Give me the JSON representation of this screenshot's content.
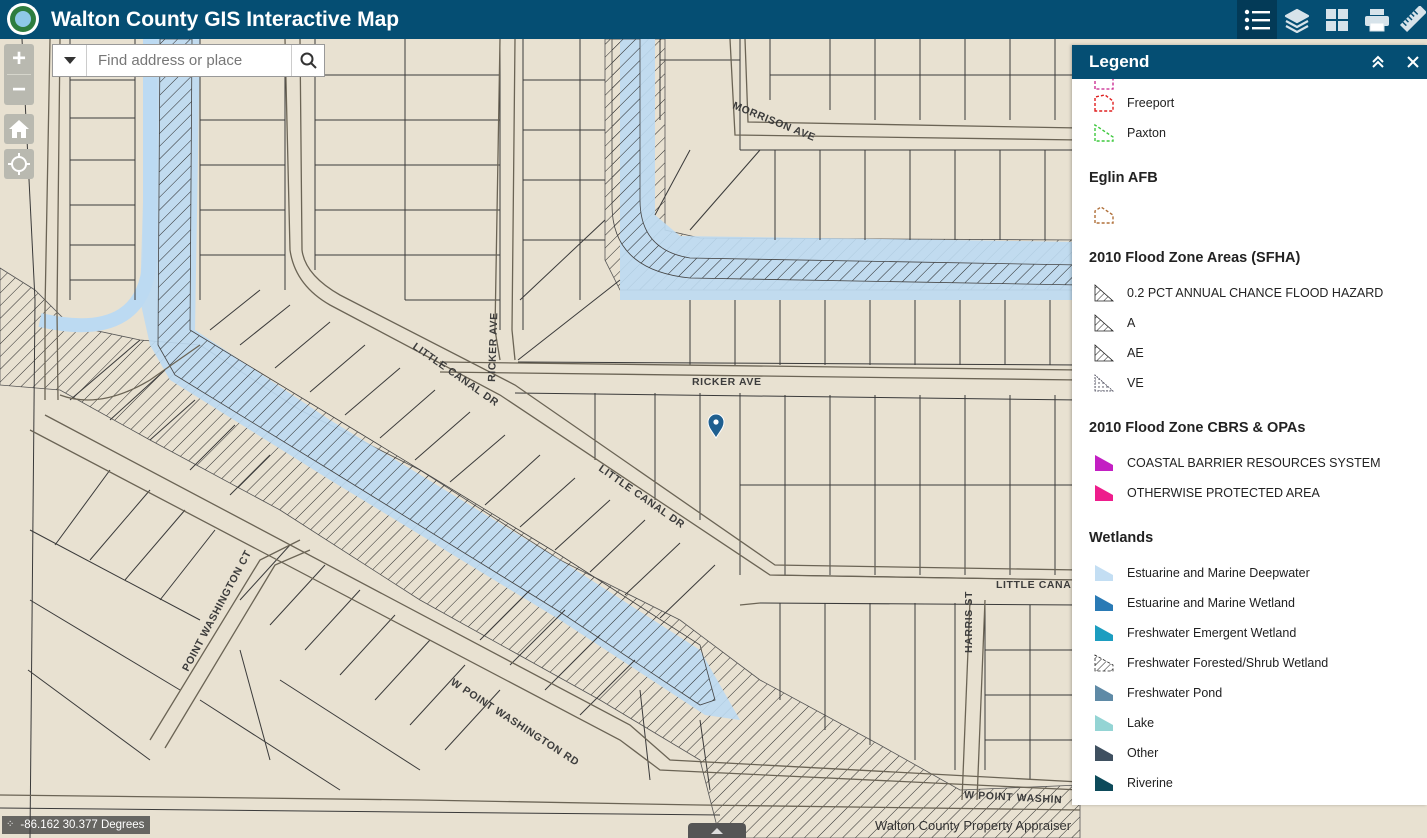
{
  "app": {
    "title": "Walton County GIS Interactive Map"
  },
  "header_tools": [
    {
      "icon": "legend-list-icon",
      "active": true
    },
    {
      "icon": "layers-icon",
      "active": false
    },
    {
      "icon": "basemap-gallery-icon",
      "active": false
    },
    {
      "icon": "print-icon",
      "active": false
    },
    {
      "icon": "measure-ruler-icon",
      "active": false
    }
  ],
  "map_controls": {
    "zoom_in": "+",
    "zoom_out": "−"
  },
  "search": {
    "placeholder": "Find address or place",
    "value": ""
  },
  "streets": [
    "MORRISON AVE",
    "RICKER AVE",
    "RICKER AVE",
    "LITTLE CANAL DR",
    "LITTLE CANAL DR",
    "LITTLE CANA",
    "HARRIS ST",
    "POINT WASHINGTON CT",
    "W POINT WASHINGTON RD",
    "W POINT WASHIN"
  ],
  "legend": {
    "title": "Legend",
    "groups": [
      {
        "title": "",
        "items": [
          {
            "label": "Freeport",
            "symbol": "dashed-outline",
            "color": "#e02020"
          },
          {
            "label": "Paxton",
            "symbol": "dashed-outline",
            "color": "#3ec83e"
          }
        ]
      },
      {
        "title": "Eglin AFB",
        "items": [
          {
            "label": "",
            "symbol": "dashed-outline",
            "color": "#b0703a"
          }
        ]
      },
      {
        "title": "2010 Flood Zone Areas (SFHA)",
        "items": [
          {
            "label": "0.2 PCT ANNUAL CHANCE FLOOD HAZARD",
            "symbol": "hatch",
            "color": "#333333"
          },
          {
            "label": "A",
            "symbol": "hatch",
            "color": "#333333"
          },
          {
            "label": "AE",
            "symbol": "hatch",
            "color": "#333333"
          },
          {
            "label": "VE",
            "symbol": "dots",
            "color": "#333333"
          }
        ]
      },
      {
        "title": "2010 Flood Zone CBRS & OPAs",
        "items": [
          {
            "label": "COASTAL BARRIER RESOURCES SYSTEM",
            "symbol": "fill",
            "color": "#c31fc3"
          },
          {
            "label": "OTHERWISE PROTECTED AREA",
            "symbol": "fill",
            "color": "#ee1d8c"
          }
        ]
      },
      {
        "title": "Wetlands",
        "items": [
          {
            "label": "Estuarine and Marine Deepwater",
            "symbol": "fill",
            "color": "#c3def3"
          },
          {
            "label": "Estuarine and Marine Wetland",
            "symbol": "fill",
            "color": "#2a7ab5"
          },
          {
            "label": "Freshwater Emergent Wetland",
            "symbol": "fill",
            "color": "#1c9dc0"
          },
          {
            "label": "Freshwater Forested/Shrub Wetland",
            "symbol": "hatch",
            "color": "#333333"
          },
          {
            "label": "Freshwater Pond",
            "symbol": "fill",
            "color": "#5f8aa6"
          },
          {
            "label": "Lake",
            "symbol": "fill",
            "color": "#94d4d4"
          },
          {
            "label": "Other",
            "symbol": "fill",
            "color": "#3f5060"
          },
          {
            "label": "Riverine",
            "symbol": "fill",
            "color": "#0d4a5a"
          }
        ]
      }
    ]
  },
  "status": {
    "coordinates": "-86.162 30.377 Degrees"
  },
  "attribution": "Walton County Property Appraiser",
  "colors": {
    "header": "#054e73",
    "map_background": "#e8e1d1",
    "water": "#bcdaf2",
    "marker": "#1f5f8f"
  }
}
